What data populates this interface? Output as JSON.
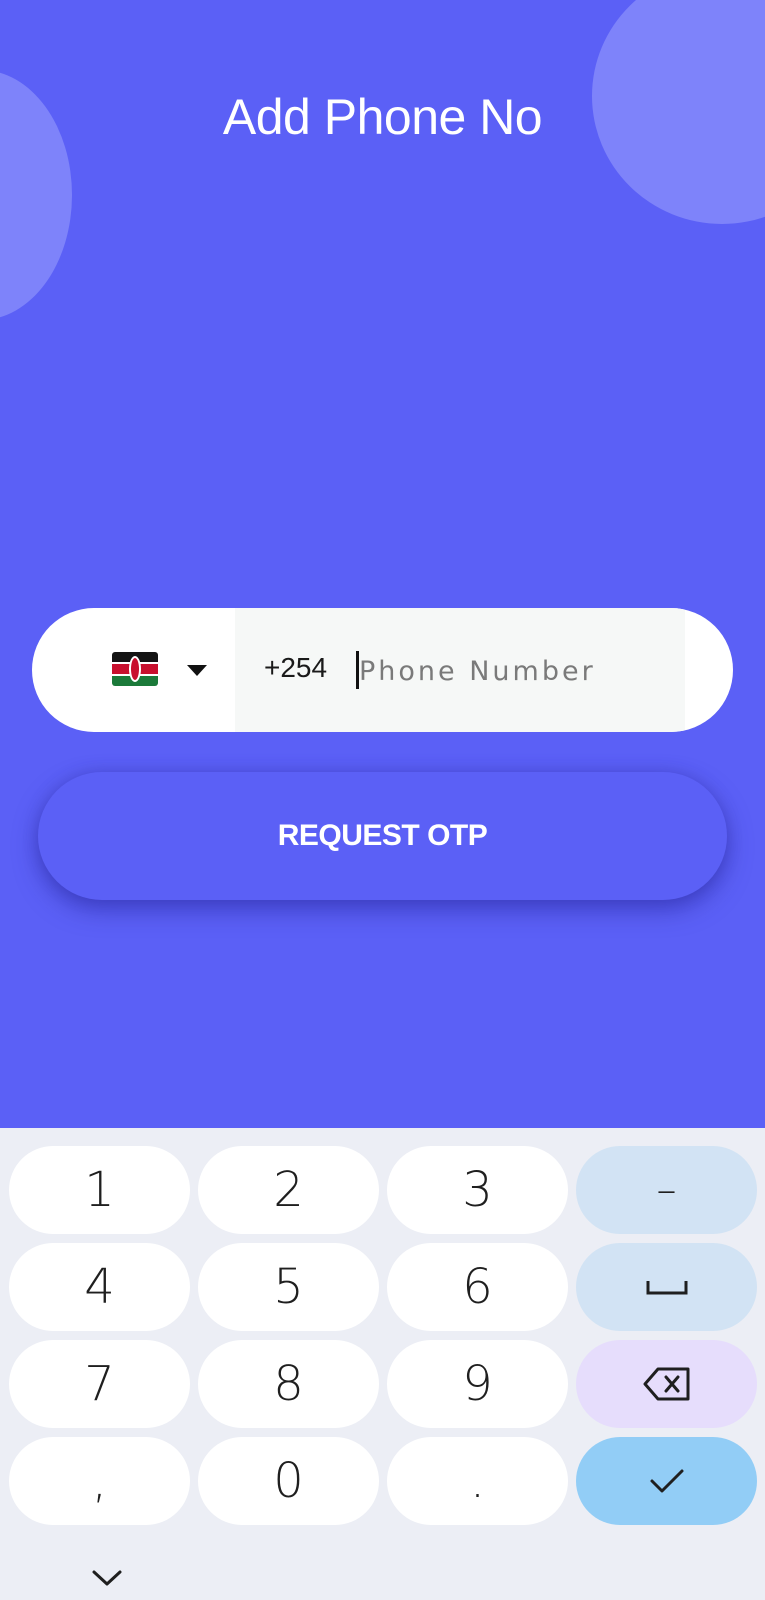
{
  "header": {
    "title": "Add Phone No"
  },
  "phone_form": {
    "country_flag": "kenya-flag",
    "dial_code": "+254",
    "phone_value": "",
    "phone_placeholder": "Phone Number"
  },
  "actions": {
    "request_otp_label": "REQUEST OTP"
  },
  "keyboard": {
    "keys": {
      "k1": "1",
      "k2": "2",
      "k3": "3",
      "dash": "–",
      "k4": "4",
      "k5": "5",
      "k6": "6",
      "k7": "7",
      "k8": "8",
      "k9": "9",
      "comma": ",",
      "k0": "0",
      "period": "."
    },
    "icons": {
      "space": "space-icon",
      "backspace": "backspace-icon",
      "enter": "checkmark-icon",
      "collapse": "chevron-down-icon"
    }
  },
  "colors": {
    "background": "#5b60f6",
    "decor_circle": "#7e83fa",
    "keyboard_bg": "#eceef5",
    "func_key": "#d2e3f4",
    "backspace_key": "#e6ddfc",
    "enter_key": "#92cdf6"
  }
}
